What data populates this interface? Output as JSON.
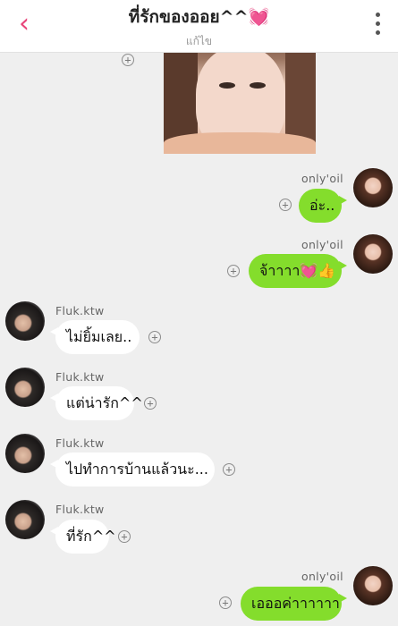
{
  "header": {
    "back_icon": "‹",
    "title": "ที่รักของออย^^",
    "title_emoji": "💓",
    "subtitle": "แก้ไข",
    "accent_color": "#e8457a"
  },
  "messages": [
    {
      "side": "out",
      "sender": "only'oil",
      "text": "อ่ะ.."
    },
    {
      "side": "out",
      "sender": "only'oil",
      "text": "จ้าาาา💓👍"
    },
    {
      "side": "in",
      "sender": "Fluk.ktw",
      "text": "ไม่ยิ้มเลย.."
    },
    {
      "side": "in",
      "sender": "Fluk.ktw",
      "text": "แต่น่ารัก^^"
    },
    {
      "side": "in",
      "sender": "Fluk.ktw",
      "text": "ไปทำการบ้านแล้วนะ..."
    },
    {
      "side": "in",
      "sender": "Fluk.ktw",
      "text": "ที่รัก^^"
    },
    {
      "side": "out",
      "sender": "only'oil",
      "text": "เอออค่าาาาาา"
    }
  ],
  "colors": {
    "outgoing_bubble": "#84dd2c",
    "incoming_bubble": "#ffffff",
    "background": "#efefef"
  },
  "icons": {
    "plus": "+",
    "more": "more-vertical-icon"
  }
}
